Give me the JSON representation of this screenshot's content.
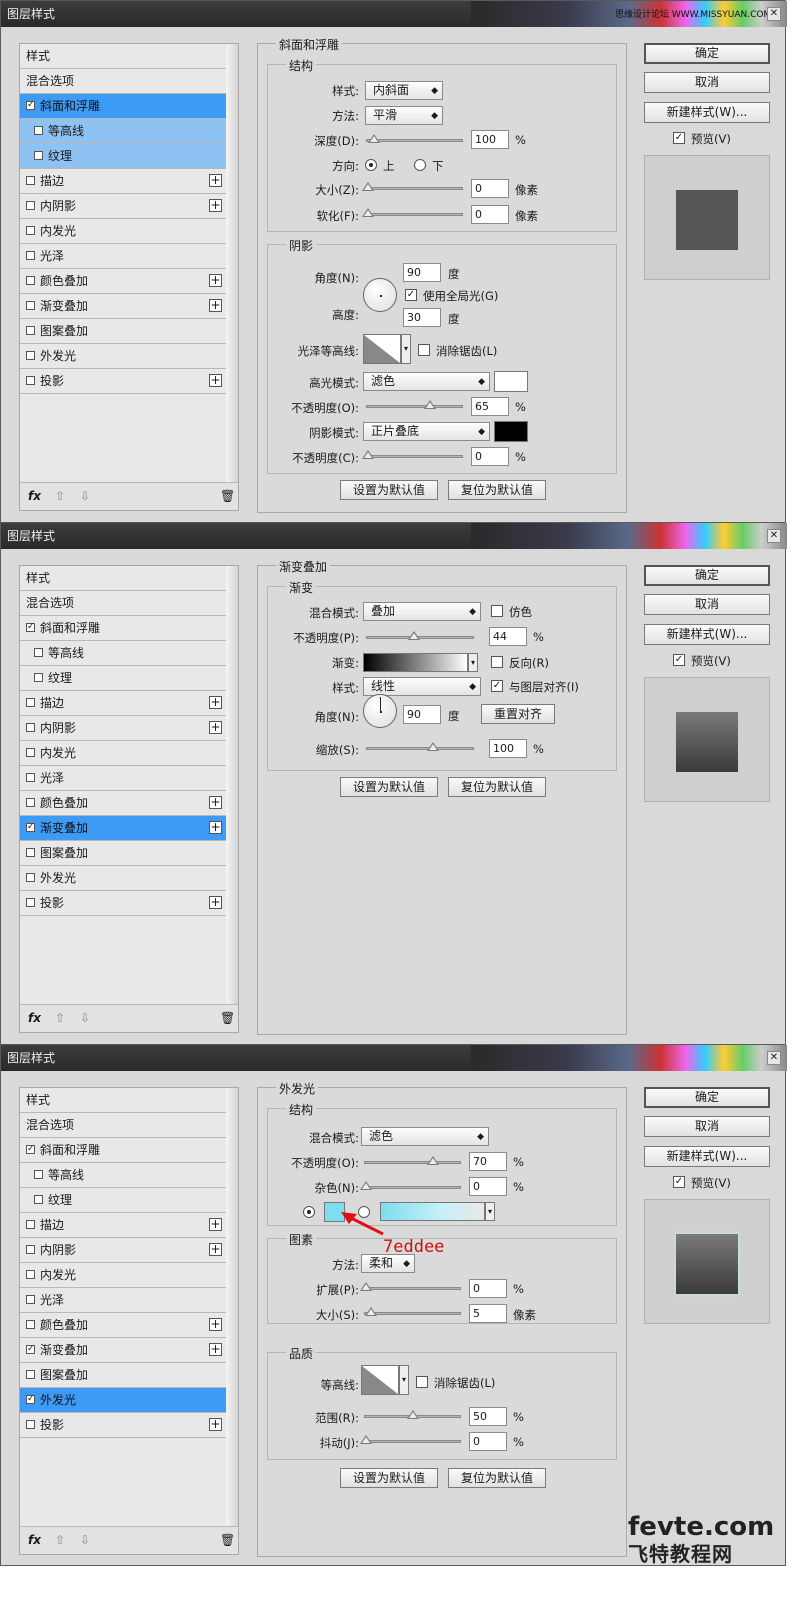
{
  "watermark": "思缘设计论坛 WWW.MISSYUAN.COM",
  "brand": {
    "line1": "fevte.com",
    "line2": "飞特教程网"
  },
  "annotation": "7eddee",
  "colors": {
    "accent": "#3d9bf5",
    "highlight_color": "#ffffff",
    "shadow_color": "#000000",
    "glow_color": "#7eddee"
  },
  "dialogs": [
    {
      "title": "图层样式",
      "left_items": [
        {
          "label": "样式"
        },
        {
          "label": "混合选项"
        },
        {
          "label": "斜面和浮雕",
          "checked": "✓"
        },
        {
          "label": "等高线"
        },
        {
          "label": "纹理"
        },
        {
          "label": "描边"
        },
        {
          "label": "内阴影"
        },
        {
          "label": "内发光"
        },
        {
          "label": "光泽"
        },
        {
          "label": "颜色叠加"
        },
        {
          "label": "渐变叠加"
        },
        {
          "label": "图案叠加"
        },
        {
          "label": "外发光"
        },
        {
          "label": "投影"
        }
      ],
      "section_title": "斜面和浮雕",
      "structure_title": "结构",
      "style_label": "样式:",
      "style_value": "内斜面",
      "method_label": "方法:",
      "method_value": "平滑",
      "depth_label": "深度(D):",
      "depth_value": "100",
      "depth_unit": "%",
      "direction_label": "方向:",
      "direction_up": "上",
      "direction_down": "下",
      "size_label": "大小(Z):",
      "size_value": "0",
      "size_unit": "像素",
      "soften_label": "软化(F):",
      "soften_value": "0",
      "soften_unit": "像素",
      "shading_title": "阴影",
      "angle_label": "角度(N):",
      "angle_value": "90",
      "angle_unit": "度",
      "global_light_label": "使用全局光(G)",
      "altitude_label": "高度:",
      "altitude_value": "30",
      "altitude_unit": "度",
      "gloss_label": "光泽等高线:",
      "antialias_label": "消除锯齿(L)",
      "highlight_mode_label": "高光模式:",
      "highlight_mode_value": "滤色",
      "hl_opacity_label": "不透明度(O):",
      "hl_opacity_value": "65",
      "hl_opacity_unit": "%",
      "shadow_mode_label": "阴影模式:",
      "shadow_mode_value": "正片叠底",
      "sh_opacity_label": "不透明度(C):",
      "sh_opacity_value": "0",
      "sh_opacity_unit": "%",
      "make_default": "设置为默认值",
      "reset_default": "复位为默认值",
      "ok": "确定",
      "cancel": "取消",
      "new_style": "新建样式(W)...",
      "preview": "预览(V)"
    },
    {
      "title": "图层样式",
      "section_title": "渐变叠加",
      "gradient_title": "渐变",
      "blend_label": "混合模式:",
      "blend_value": "叠加",
      "dither_label": "仿色",
      "opacity_label": "不透明度(P):",
      "opacity_value": "44",
      "opacity_unit": "%",
      "gradient_label": "渐变:",
      "reverse_label": "反向(R)",
      "style_label": "样式:",
      "style_value": "线性",
      "align_label": "与图层对齐(I)",
      "angle_label": "角度(N):",
      "angle_value": "90",
      "angle_unit": "度",
      "reset_align": "重置对齐",
      "scale_label": "缩放(S):",
      "scale_value": "100",
      "scale_unit": "%",
      "make_default": "设置为默认值",
      "reset_default": "复位为默认值",
      "ok": "确定",
      "cancel": "取消",
      "new_style": "新建样式(W)...",
      "preview": "预览(V)"
    },
    {
      "title": "图层样式",
      "section_title": "外发光",
      "structure_title": "结构",
      "blend_label": "混合模式:",
      "blend_value": "滤色",
      "opacity_label": "不透明度(O):",
      "opacity_value": "70",
      "opacity_unit": "%",
      "noise_label": "杂色(N):",
      "noise_value": "0",
      "noise_unit": "%",
      "elements_title": "图素",
      "technique_label": "方法:",
      "technique_value": "柔和",
      "spread_label": "扩展(P):",
      "spread_value": "0",
      "spread_unit": "%",
      "size_label": "大小(S):",
      "size_value": "5",
      "size_unit": "像素",
      "quality_title": "品质",
      "contour_label": "等高线:",
      "antialias_label": "消除锯齿(L)",
      "range_label": "范围(R):",
      "range_value": "50",
      "range_unit": "%",
      "jitter_label": "抖动(J):",
      "jitter_value": "0",
      "jitter_unit": "%",
      "make_default": "设置为默认值",
      "reset_default": "复位为默认值",
      "ok": "确定",
      "cancel": "取消",
      "new_style": "新建样式(W)...",
      "preview": "预览(V)"
    }
  ]
}
